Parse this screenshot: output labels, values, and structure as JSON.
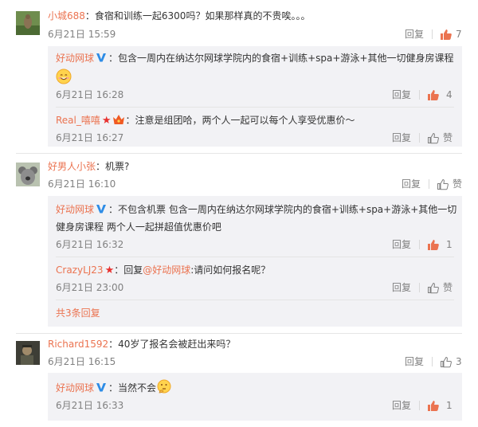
{
  "comments": [
    {
      "user": "小城688",
      "text": "：食宿和训练一起6300吗？如果那样真的不贵唉。。。",
      "time": "6月21日 15:59",
      "reply_label": "回复",
      "likes": "7",
      "replies": [
        {
          "user": "好动网球",
          "verified": true,
          "text_line1": "：包含一周内在纳达尔网球学院内的食宿+训练+spa+游泳+其他一切健身房课程",
          "emoji": "smile",
          "time": "6月21日 16:28",
          "reply_label": "回复",
          "likes": "4"
        },
        {
          "user": "Real_嘻嘻",
          "badges": [
            "red-star-icon",
            "crown-icon"
          ],
          "text": "：注意是组团哈，两个人一起可以每个人享受优惠价～",
          "time": "6月21日 16:27",
          "reply_label": "回复",
          "likes": "赞"
        }
      ]
    },
    {
      "user": "好男人小张",
      "text": "：机票?",
      "time": "6月21日 16:10",
      "reply_label": "回复",
      "likes": "赞",
      "replies": [
        {
          "user": "好动网球",
          "verified": true,
          "text_line1": "：不包含机票 包含一周内在纳达尔网球学院内的食宿+训练+spa+游泳+其他一切",
          "text_line2": "健身房课程 两个人一起拼超值优惠价吧",
          "time": "6月21日 16:32",
          "reply_label": "回复",
          "likes": "1"
        },
        {
          "user": "CrazyLJ23",
          "badges": [
            "red-star-icon"
          ],
          "text_prefix": "：回复",
          "mention": "@好动网球",
          "text": ":请问如何报名呢？",
          "time": "6月21日 23:00",
          "reply_label": "回复",
          "likes": "赞"
        }
      ],
      "more_replies": "共3条回复"
    },
    {
      "user": "Richard1592",
      "text": "：40岁了报名会被赶出来吗？",
      "time": "6月21日 16:15",
      "reply_label": "回复",
      "likes": "3",
      "replies": [
        {
          "user": "好动网球",
          "verified": true,
          "text": "：当然不会",
          "emoji": "think",
          "time": "6月21日 16:33",
          "reply_label": "回复",
          "likes": "1"
        }
      ]
    }
  ],
  "colors": {
    "username": "#eb7350",
    "liked": "#eb7350",
    "verified": "#2d8ce6",
    "reply_bg": "#f2f2f5",
    "gray_text": "#808080"
  }
}
